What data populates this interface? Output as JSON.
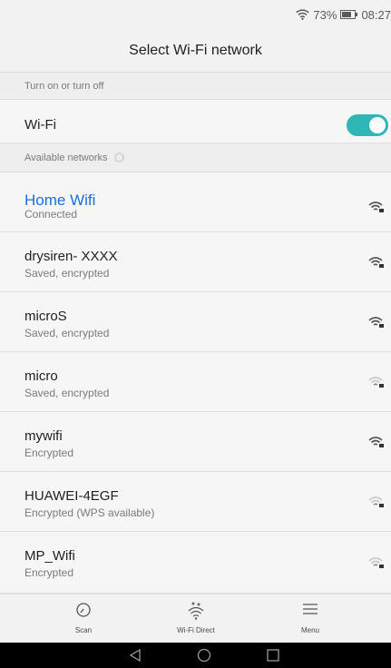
{
  "status_bar": {
    "battery": "73%",
    "time": "08:27"
  },
  "title": "Select Wi-Fi network",
  "toggle_section": {
    "header": "Turn on or turn off",
    "label": "Wi-Fi",
    "enabled": true,
    "accent": "#30b6b6"
  },
  "networks_section": {
    "header": "Available networks"
  },
  "networks": [
    {
      "name": "Home Wifi",
      "status": "Connected",
      "connected": true,
      "signal": "strong"
    },
    {
      "name": "drysiren- XXXX",
      "status": "Saved, encrypted",
      "signal": "strong"
    },
    {
      "name": "microS",
      "status": "Saved, encrypted",
      "signal": "strong"
    },
    {
      "name": "micro",
      "status": "Saved, encrypted",
      "signal": "weak"
    },
    {
      "name": "mywifi",
      "status": "Encrypted",
      "signal": "strong"
    },
    {
      "name": "HUAWEI-4EGF",
      "status": "Encrypted (WPS available)",
      "signal": "weak"
    },
    {
      "name": "MP_Wifi",
      "status": "Encrypted",
      "signal": "weak"
    }
  ],
  "bottom_bar": {
    "scan": "Scan",
    "wifi_direct": "Wi-Fi Direct",
    "menu": "Menu"
  },
  "colors": {
    "connected": "#1a6fe0",
    "toggle": "#30b6b6"
  }
}
